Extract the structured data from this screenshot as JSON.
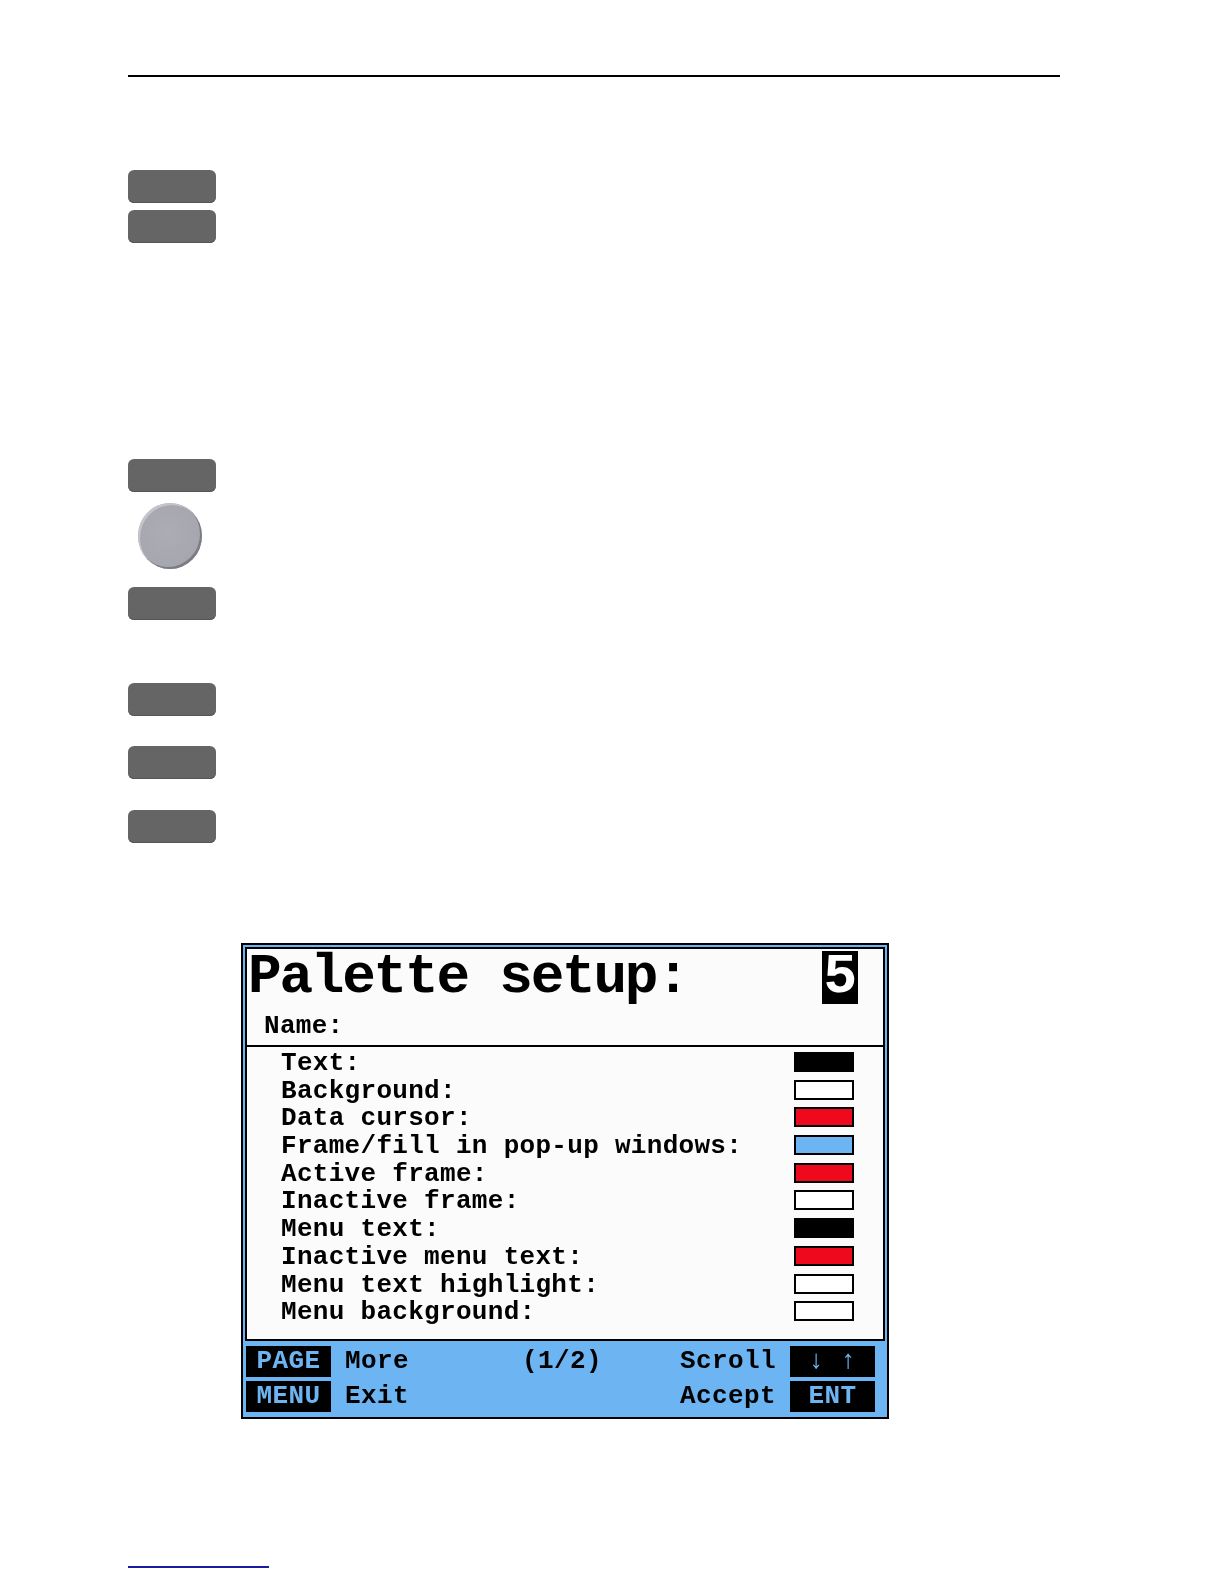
{
  "screen": {
    "title": "Palette setup:",
    "palette_number": "5",
    "name_label": "Name:",
    "settings": [
      {
        "label": "Text:",
        "color": "#000000"
      },
      {
        "label": "Background:",
        "color": "#ffffff"
      },
      {
        "label": "Data cursor:",
        "color": "#ee0a1c"
      },
      {
        "label": "Frame/fill in pop-up windows:",
        "color": "#6cb4f2"
      },
      {
        "label": "Active frame:",
        "color": "#ee0a1c"
      },
      {
        "label": "Inactive frame:",
        "color": "#ffffff"
      },
      {
        "label": "Menu text:",
        "color": "#000000"
      },
      {
        "label": "Inactive menu text:",
        "color": "#ee0a1c"
      },
      {
        "label": "Menu text highlight:",
        "color": "#ffffff"
      },
      {
        "label": "Menu background:",
        "color": "#ffffff"
      }
    ],
    "footer": {
      "rows": [
        {
          "left_key": "PAGE",
          "left_label": "More",
          "center": "(1/2)",
          "right_label": "Scroll",
          "right_key": "↓ ↑"
        },
        {
          "left_key": "MENU",
          "left_label": "Exit",
          "right_label": "Accept",
          "right_key": "ENT"
        }
      ]
    }
  }
}
